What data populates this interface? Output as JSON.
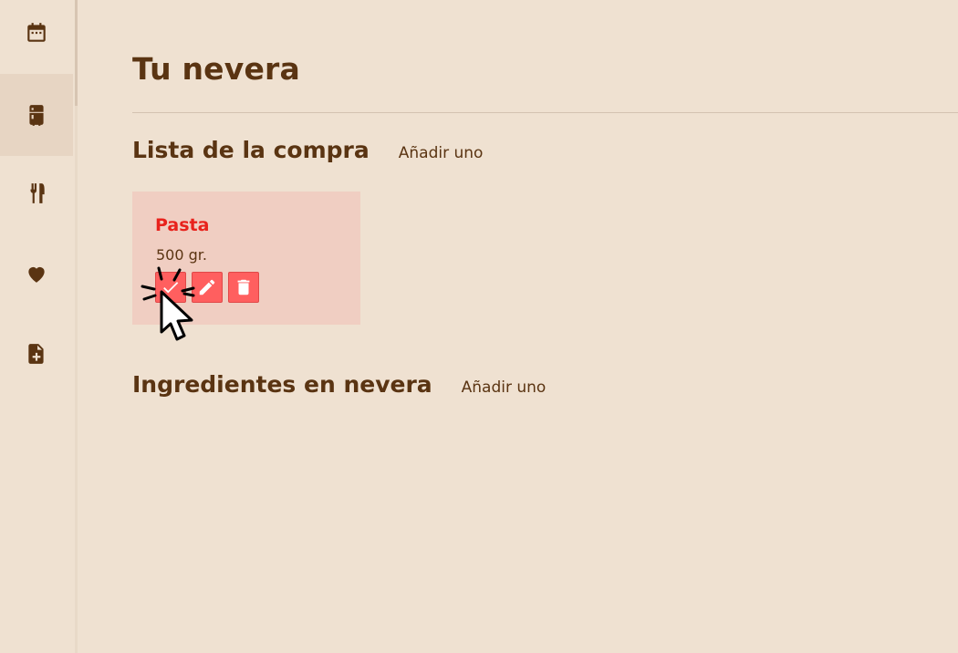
{
  "sidebar": {
    "items": [
      {
        "name": "calendar",
        "icon": "calendar-icon",
        "active": false
      },
      {
        "name": "fridge",
        "icon": "fridge-icon",
        "active": true
      },
      {
        "name": "recipes",
        "icon": "utensils-icon",
        "active": false
      },
      {
        "name": "favorites",
        "icon": "heart-icon",
        "active": false
      },
      {
        "name": "new-document",
        "icon": "file-plus-icon",
        "active": false
      }
    ]
  },
  "main": {
    "title": "Tu nevera",
    "shopping_list": {
      "title": "Lista de la compra",
      "add_label": "Añadir uno",
      "items": [
        {
          "name": "Pasta",
          "quantity": "500 gr."
        }
      ]
    },
    "fridge_ingredients": {
      "title": "Ingredientes en nevera",
      "add_label": "Añadir uno"
    }
  },
  "colors": {
    "background": "#efe1d1",
    "text": "#5a3412",
    "card": "#f0cec2",
    "item_name": "#e8221c",
    "action_button": "#ff5f5f"
  }
}
